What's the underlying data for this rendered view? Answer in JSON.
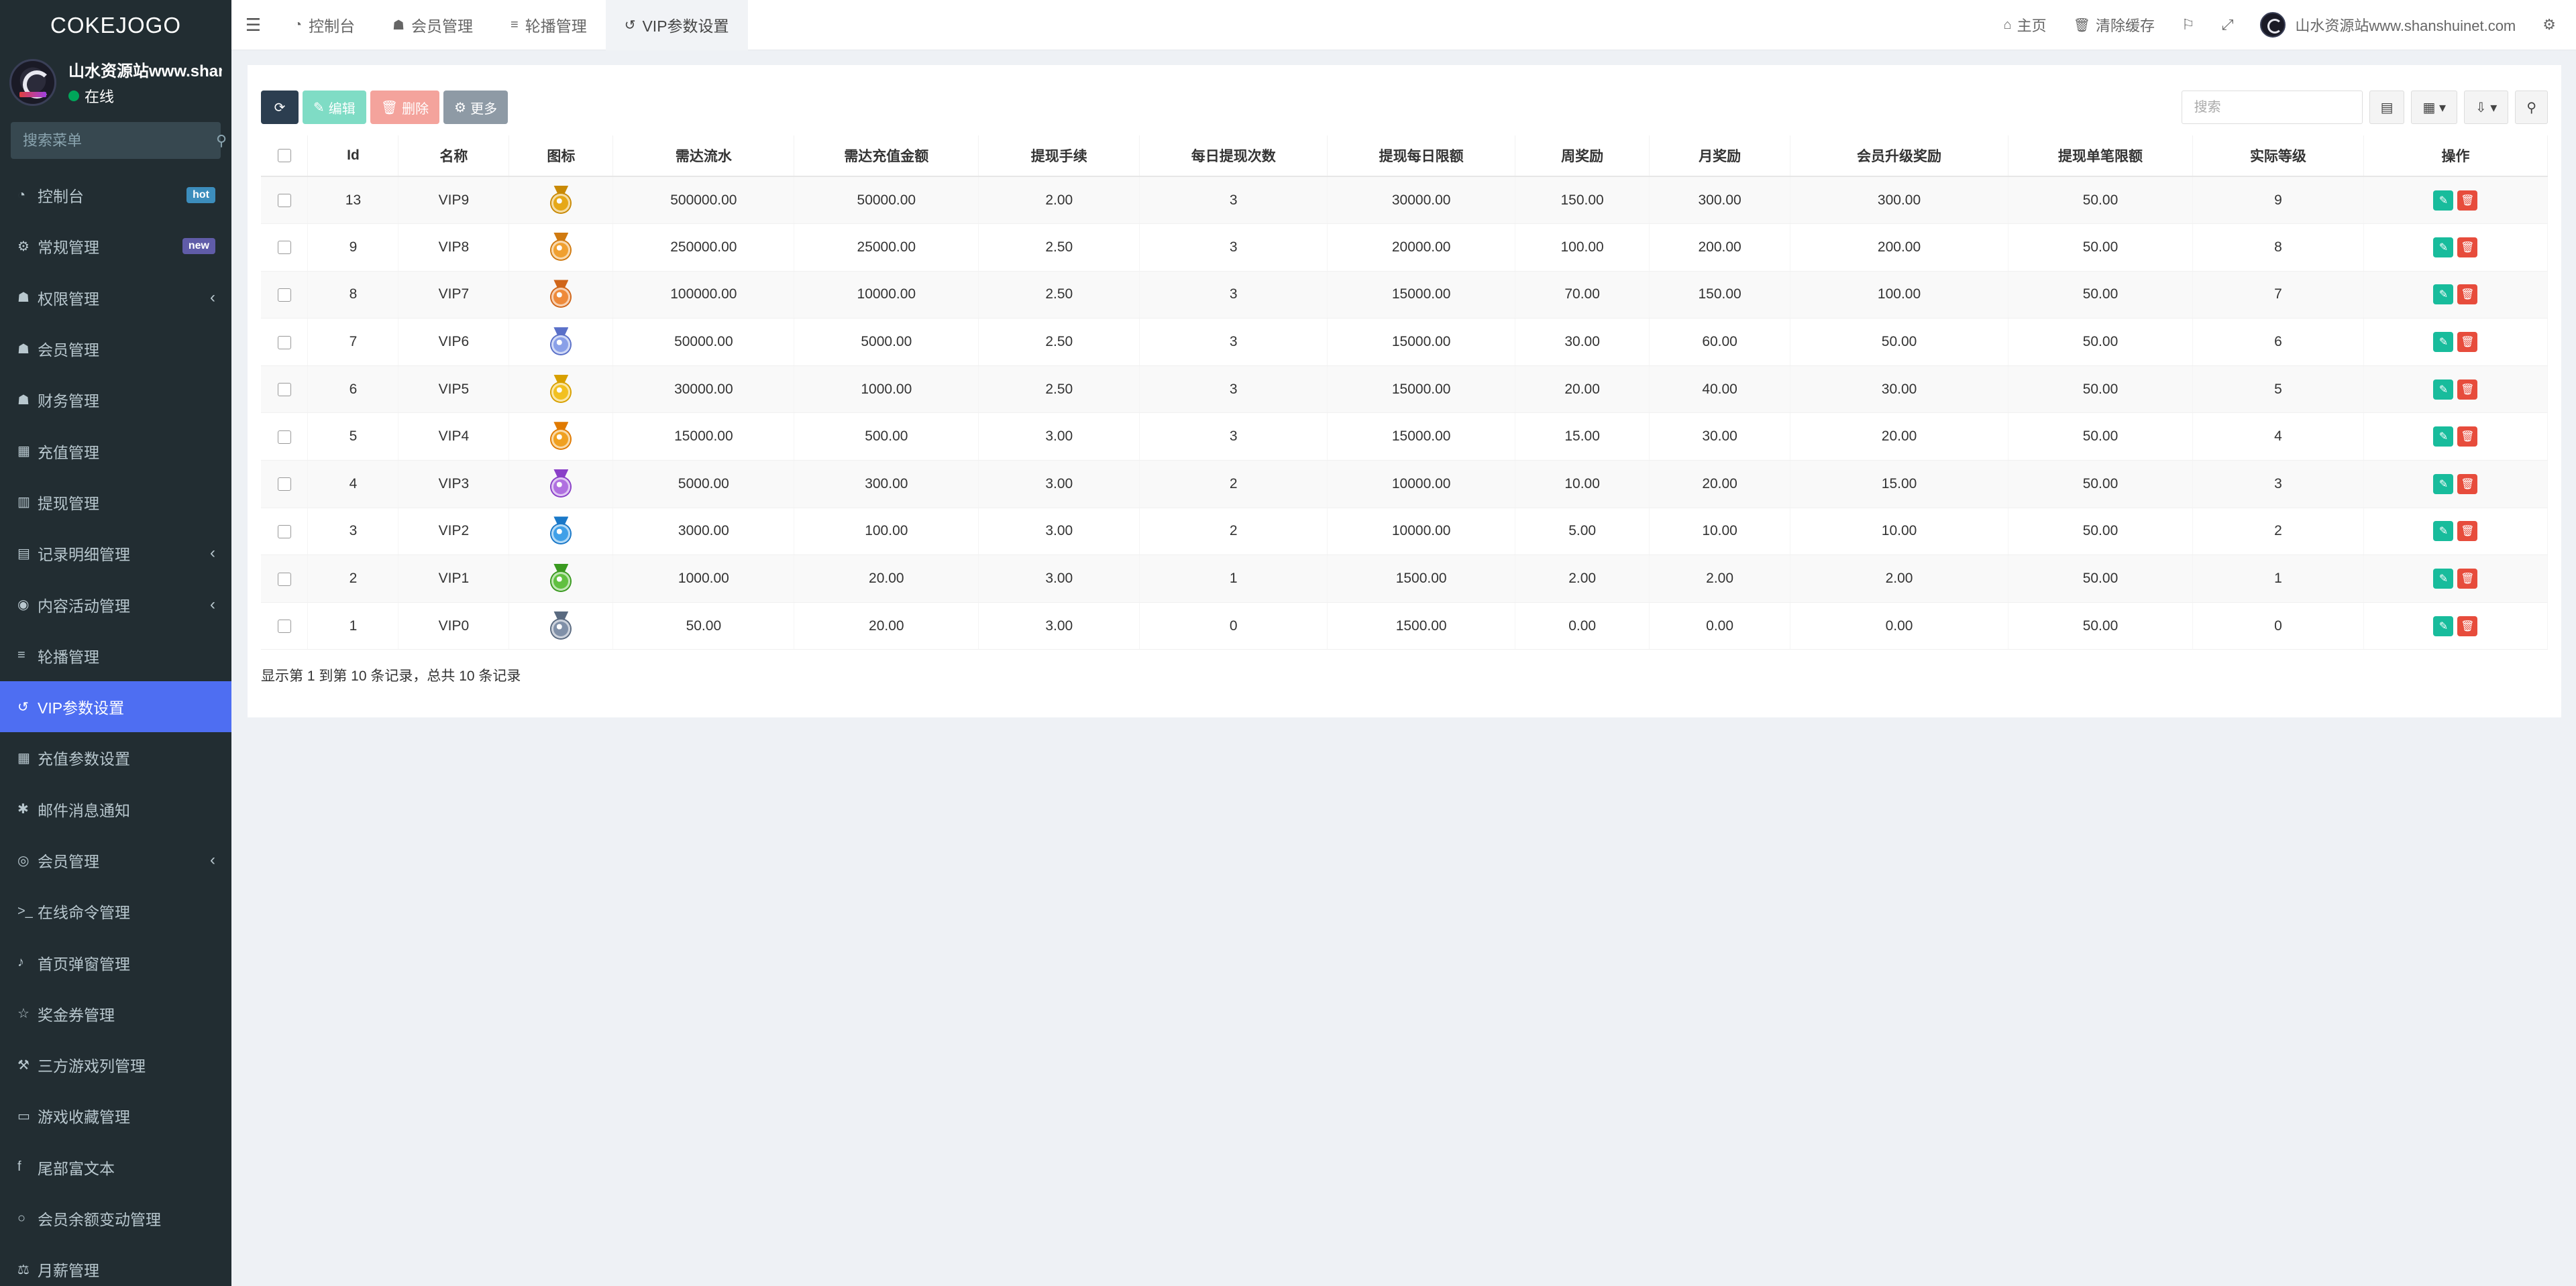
{
  "brand": "COKEJOGO",
  "user": {
    "name": "山水资源站www.shanshu",
    "status": "在线"
  },
  "sidebar_search": {
    "placeholder": "搜索菜单"
  },
  "menu": [
    {
      "label": "控制台",
      "icon": "dashboard-icon",
      "glyph": "◔",
      "badge": "hot"
    },
    {
      "label": "常规管理",
      "icon": "cogs-icon",
      "glyph": "⚙",
      "badge": "new"
    },
    {
      "label": "权限管理",
      "icon": "group-icon",
      "glyph": "☗",
      "chevron": true
    },
    {
      "label": "会员管理",
      "icon": "users-icon",
      "glyph": "☗"
    },
    {
      "label": "财务管理",
      "icon": "users-icon",
      "glyph": "☗"
    },
    {
      "label": "充值管理",
      "icon": "grid-icon",
      "glyph": "▦"
    },
    {
      "label": "提现管理",
      "icon": "chart-bar-icon",
      "glyph": "▥"
    },
    {
      "label": "记录明细管理",
      "icon": "chart-icon",
      "glyph": "▤",
      "chevron": true
    },
    {
      "label": "内容活动管理",
      "icon": "circle-icon",
      "glyph": "◉",
      "chevron": true
    },
    {
      "label": "轮播管理",
      "icon": "list-icon",
      "glyph": "≡"
    },
    {
      "label": "VIP参数设置",
      "icon": "history-icon",
      "glyph": "↺",
      "active": true
    },
    {
      "label": "充值参数设置",
      "icon": "grid-icon",
      "glyph": "▦"
    },
    {
      "label": "邮件消息通知",
      "icon": "asterisk-icon",
      "glyph": "✱"
    },
    {
      "label": "会员管理",
      "icon": "user-circle-icon",
      "glyph": "◎",
      "chevron": true
    },
    {
      "label": "在线命令管理",
      "icon": "terminal-icon",
      "glyph": ">_"
    },
    {
      "label": "首页弹窗管理",
      "icon": "bell-icon",
      "glyph": "♪"
    },
    {
      "label": "奖金券管理",
      "icon": "star-icon",
      "glyph": "☆"
    },
    {
      "label": "三方游戏列管理",
      "icon": "gavel-icon",
      "glyph": "⚒"
    },
    {
      "label": "游戏收藏管理",
      "icon": "folder-open-icon",
      "glyph": "▭"
    },
    {
      "label": "尾部富文本",
      "icon": "facebook-icon",
      "glyph": "f"
    },
    {
      "label": "会员余额变动管理",
      "icon": "circle-outline-icon",
      "glyph": "○"
    },
    {
      "label": "月薪管理",
      "icon": "balance-icon",
      "glyph": "⚖"
    }
  ],
  "tabs": [
    {
      "label": "控制台",
      "glyph": "◔",
      "icon": "dashboard-icon"
    },
    {
      "label": "会员管理",
      "glyph": "☗",
      "icon": "user-icon"
    },
    {
      "label": "轮播管理",
      "glyph": "≡",
      "icon": "list-icon"
    },
    {
      "label": "VIP参数设置",
      "glyph": "↺",
      "icon": "history-icon",
      "active": true
    }
  ],
  "topright": {
    "home": "主页",
    "clear_cache": "清除缓存",
    "username": "山水资源站www.shanshuinet.com"
  },
  "toolbar": {
    "edit": "编辑",
    "delete": "删除",
    "more": "更多"
  },
  "table_search": {
    "placeholder": "搜索"
  },
  "columns": [
    "Id",
    "名称",
    "图标",
    "需达流水",
    "需达充值金额",
    "提现手续",
    "每日提现次数",
    "提现每日限额",
    "周奖励",
    "月奖励",
    "会员升级奖励",
    "提现单笔限额",
    "实际等级",
    "操作"
  ],
  "rows": [
    {
      "id": "13",
      "name": "VIP9",
      "medal": [
        "#e6a817",
        "#c98a06"
      ],
      "flow": "500000.00",
      "recharge": "50000.00",
      "fee": "2.00",
      "times": "3",
      "daily": "30000.00",
      "week": "150.00",
      "month": "300.00",
      "upgrade": "300.00",
      "single": "50.00",
      "level": "9"
    },
    {
      "id": "9",
      "name": "VIP8",
      "medal": [
        "#f0a030",
        "#d07a10"
      ],
      "flow": "250000.00",
      "recharge": "25000.00",
      "fee": "2.50",
      "times": "3",
      "daily": "20000.00",
      "week": "100.00",
      "month": "200.00",
      "upgrade": "200.00",
      "single": "50.00",
      "level": "8"
    },
    {
      "id": "8",
      "name": "VIP7",
      "medal": [
        "#ee8a3a",
        "#d0661a"
      ],
      "flow": "100000.00",
      "recharge": "10000.00",
      "fee": "2.50",
      "times": "3",
      "daily": "15000.00",
      "week": "70.00",
      "month": "150.00",
      "upgrade": "100.00",
      "single": "50.00",
      "level": "7"
    },
    {
      "id": "7",
      "name": "VIP6",
      "medal": [
        "#8aa0e8",
        "#5a70c8"
      ],
      "flow": "50000.00",
      "recharge": "5000.00",
      "fee": "2.50",
      "times": "3",
      "daily": "15000.00",
      "week": "30.00",
      "month": "60.00",
      "upgrade": "50.00",
      "single": "50.00",
      "level": "6"
    },
    {
      "id": "6",
      "name": "VIP5",
      "medal": [
        "#f2c020",
        "#d8a000"
      ],
      "flow": "30000.00",
      "recharge": "1000.00",
      "fee": "2.50",
      "times": "3",
      "daily": "15000.00",
      "week": "20.00",
      "month": "40.00",
      "upgrade": "30.00",
      "single": "50.00",
      "level": "5"
    },
    {
      "id": "5",
      "name": "VIP4",
      "medal": [
        "#f0a020",
        "#e07a00"
      ],
      "flow": "15000.00",
      "recharge": "500.00",
      "fee": "3.00",
      "times": "3",
      "daily": "15000.00",
      "week": "15.00",
      "month": "30.00",
      "upgrade": "20.00",
      "single": "50.00",
      "level": "4"
    },
    {
      "id": "4",
      "name": "VIP3",
      "medal": [
        "#b070e0",
        "#8a40c8"
      ],
      "flow": "5000.00",
      "recharge": "300.00",
      "fee": "3.00",
      "times": "2",
      "daily": "10000.00",
      "week": "10.00",
      "month": "20.00",
      "upgrade": "15.00",
      "single": "50.00",
      "level": "3"
    },
    {
      "id": "3",
      "name": "VIP2",
      "medal": [
        "#40a0e8",
        "#1a78c8"
      ],
      "flow": "3000.00",
      "recharge": "100.00",
      "fee": "3.00",
      "times": "2",
      "daily": "10000.00",
      "week": "5.00",
      "month": "10.00",
      "upgrade": "10.00",
      "single": "50.00",
      "level": "2"
    },
    {
      "id": "2",
      "name": "VIP1",
      "medal": [
        "#60c040",
        "#3a9a20"
      ],
      "flow": "1000.00",
      "recharge": "20.00",
      "fee": "3.00",
      "times": "1",
      "daily": "1500.00",
      "week": "2.00",
      "month": "2.00",
      "upgrade": "2.00",
      "single": "50.00",
      "level": "1"
    },
    {
      "id": "1",
      "name": "VIP0",
      "medal": [
        "#8090a8",
        "#5a6a80"
      ],
      "flow": "50.00",
      "recharge": "20.00",
      "fee": "3.00",
      "times": "0",
      "daily": "1500.00",
      "week": "0.00",
      "month": "0.00",
      "upgrade": "0.00",
      "single": "50.00",
      "level": "0"
    }
  ],
  "pager_info": "显示第 1 到第 10 条记录，总共 10 条记录"
}
